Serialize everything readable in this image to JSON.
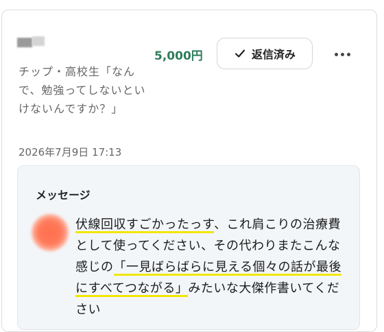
{
  "item": {
    "title": "チップ・高校生「なんで、勉強ってしないといけないんですか？」",
    "date": "2026年7月9日 17:13",
    "amount": "5,000円"
  },
  "actions": {
    "replied_label": "返信済み",
    "replied_icon": "check-icon",
    "more_icon": "more-horizontal-icon"
  },
  "message": {
    "heading": "メッセージ",
    "segments": [
      {
        "text": "伏線回収すごかったっす",
        "highlight": true
      },
      {
        "text": "、これ肩こりの治療費として使ってください、その代わりまたこんな感じの",
        "highlight": false
      },
      {
        "text": "「一見ばらばらに見える個々の話が最後にすべてつながる」",
        "highlight": true
      },
      {
        "text": "みたいな大傑作書いてください",
        "highlight": false
      }
    ]
  },
  "colors": {
    "amount": "#2e7d5b",
    "highlight": "#f2e600",
    "message_bg": "#f3f6f9"
  }
}
